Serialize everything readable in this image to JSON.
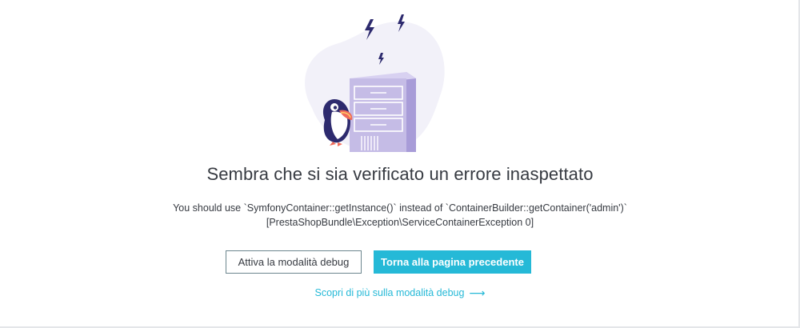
{
  "error": {
    "title": "Sembra che si sia verificato un errore inaspettato",
    "message_line1": "You should use `SymfonyContainer::getInstance()` instead of `ContainerBuilder::getContainer('admin')`",
    "message_line2": "[PrestaShopBundle\\Exception\\ServiceContainerException 0]"
  },
  "actions": {
    "debug_button": "Attiva la modalità debug",
    "back_button": "Torna alla pagina precedente",
    "learn_more_link": "Scopri di più sulla modalità debug",
    "learn_more_arrow": "⟶"
  },
  "colors": {
    "primary": "#25b9d7",
    "text": "#363a41",
    "outline_border": "#6c868e",
    "server": "#c5bce6",
    "bolt": "#2d2a6e",
    "blob": "#f2f1f9"
  },
  "illustration": {
    "icons": [
      "lightning-bolt-icon",
      "server-icon",
      "puffin-mascot-icon"
    ]
  }
}
